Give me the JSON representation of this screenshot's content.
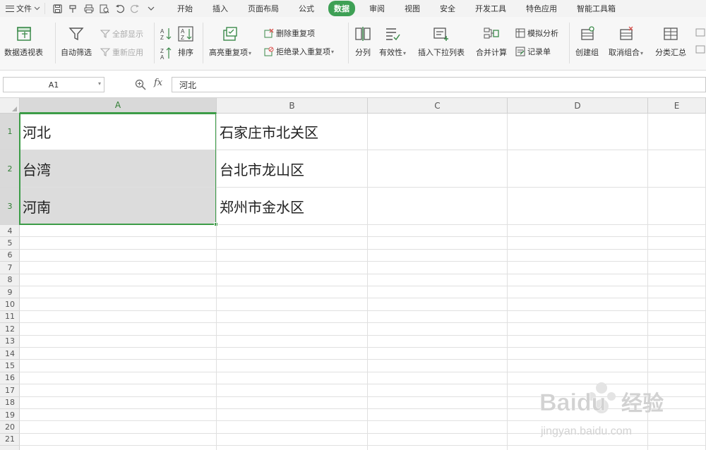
{
  "menu": {
    "file_label": "文件",
    "tabs": [
      {
        "label": "开始"
      },
      {
        "label": "插入"
      },
      {
        "label": "页面布局"
      },
      {
        "label": "公式"
      },
      {
        "label": "数据",
        "active": true
      },
      {
        "label": "审阅"
      },
      {
        "label": "视图"
      },
      {
        "label": "安全"
      },
      {
        "label": "开发工具"
      },
      {
        "label": "特色应用"
      },
      {
        "label": "智能工具箱"
      }
    ]
  },
  "ribbon": {
    "pivot_table": "数据透视表",
    "auto_filter": "自动筛选",
    "show_all": "全部显示",
    "reapply": "重新应用",
    "sort": "排序",
    "highlight_dup": "高亮重复项",
    "remove_dup": "删除重复项",
    "reject_dup": "拒绝录入重复项",
    "split_column": "分列",
    "validation": "有效性",
    "insert_dropdown": "插入下拉列表",
    "consolidate": "合并计算",
    "what_if": "模拟分析",
    "record_form": "记录单",
    "create_group": "创建组",
    "ungroup": "取消组合",
    "subtotal": "分类汇总"
  },
  "formula_bar": {
    "name_box": "A1",
    "fx_label": "fx",
    "formula": "河北"
  },
  "sheet": {
    "columns": [
      "A",
      "B",
      "C",
      "D",
      "E"
    ],
    "selected_column": "A",
    "row_numbers": [
      "1",
      "2",
      "3",
      "4",
      "5",
      "6",
      "7",
      "8",
      "9",
      "10",
      "11",
      "12",
      "13",
      "14",
      "15",
      "16",
      "17",
      "18",
      "19",
      "20",
      "21"
    ],
    "rows": [
      {
        "A": "河北",
        "B": "石家庄市北关区"
      },
      {
        "A": "台湾",
        "B": "台北市龙山区"
      },
      {
        "A": "河南",
        "B": "郑州市金水区"
      }
    ]
  },
  "watermark": {
    "brand": "Baidu",
    "brand_cn": "经验",
    "url": "jingyan.baidu.com"
  },
  "colors": {
    "accent_green": "#3ea055",
    "selection_border": "#3c9c47",
    "selected_fill": "#dcdcdc"
  }
}
